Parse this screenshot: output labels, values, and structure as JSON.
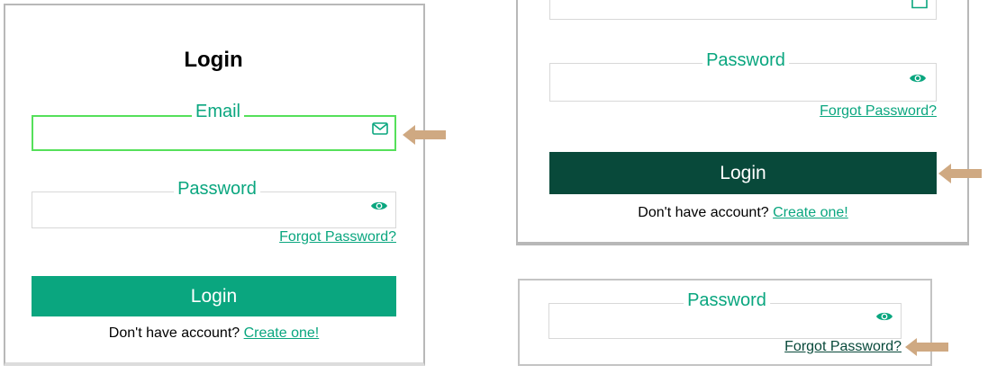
{
  "colors": {
    "accent": "#0aa67f",
    "button_primary": "#0aa67f",
    "button_dark": "#08493a",
    "focus_border": "#55e05a",
    "arrow": "#cfa982",
    "panel_border": "#b8b8b8"
  },
  "left_panel": {
    "title": "Login",
    "email": {
      "label": "Email",
      "value": "",
      "icon": "mail-icon"
    },
    "password": {
      "label": "Password",
      "value": "",
      "icon": "eye-icon"
    },
    "forgot_link": "Forgot Password?",
    "login_button": "Login",
    "signup_prompt": "Don't have account?",
    "signup_link": "Create one!"
  },
  "right_top_panel": {
    "password": {
      "label": "Password",
      "value": "",
      "icon": "eye-icon"
    },
    "forgot_link": "Forgot Password?",
    "login_button": "Login",
    "signup_prompt": "Don't have account?",
    "signup_link": "Create one!"
  },
  "right_bottom_panel": {
    "password": {
      "label": "Password",
      "value": "",
      "icon": "eye-icon"
    },
    "forgot_link": "Forgot Password?"
  }
}
